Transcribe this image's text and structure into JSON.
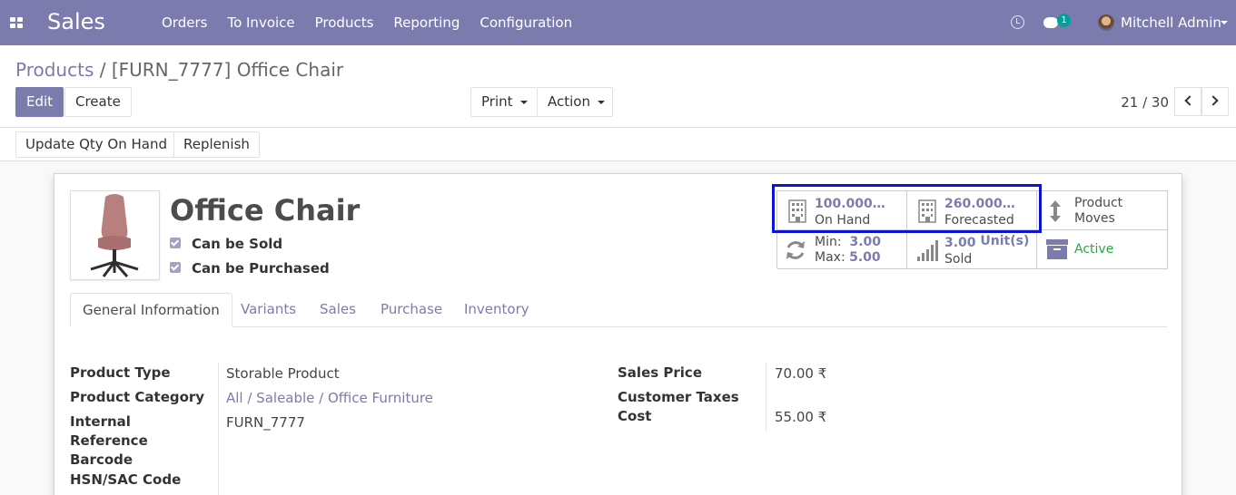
{
  "navbar": {
    "app_name": "Sales",
    "menu": [
      "Orders",
      "To Invoice",
      "Products",
      "Reporting",
      "Configuration"
    ],
    "chat_count": "1",
    "user_name": "Mitchell Admin",
    "color": "#7c7bad"
  },
  "breadcrumb": {
    "parent": "Products",
    "separator": "/",
    "current": "[FURN_7777] Office Chair"
  },
  "toolbar": {
    "edit": "Edit",
    "create": "Create",
    "print": "Print",
    "action": "Action"
  },
  "pager": {
    "text": "21 / 30"
  },
  "statusbar": {
    "update_qty": "Update Qty On Hand",
    "replenish": "Replenish"
  },
  "product": {
    "name": "Office Chair",
    "can_be_sold": "Can be Sold",
    "can_be_purchased": "Can be Purchased"
  },
  "smart_buttons": {
    "on_hand_value": "100.000…",
    "on_hand_label": "On Hand",
    "forecasted_value": "260.000…",
    "forecasted_label": "Forecasted",
    "moves_line1": "Product",
    "moves_line2": "Moves",
    "min_label": "Min:",
    "min_value": "3.00",
    "max_label": "Max:",
    "max_value": "5.00",
    "sold_value": "3.00",
    "sold_unit": "Unit(s)",
    "sold_label": "Sold",
    "active_label": "Active",
    "active_color": "#28a745"
  },
  "tabs": [
    "General Information",
    "Variants",
    "Sales",
    "Purchase",
    "Inventory"
  ],
  "fields_left": {
    "product_type_label": "Product Type",
    "product_type_value": "Storable Product",
    "category_label": "Product Category",
    "category_value": "All / Saleable / Office Furniture",
    "internal_ref_label_1": "Internal",
    "internal_ref_label_2": "Reference",
    "internal_ref_value": "FURN_7777",
    "barcode_label": "Barcode",
    "hsn_label": "HSN/SAC Code"
  },
  "fields_right": {
    "sales_price_label": "Sales Price",
    "sales_price_value": "70.00 ₹",
    "customer_taxes_label": "Customer Taxes",
    "cost_label": "Cost",
    "cost_value": "55.00 ₹"
  }
}
